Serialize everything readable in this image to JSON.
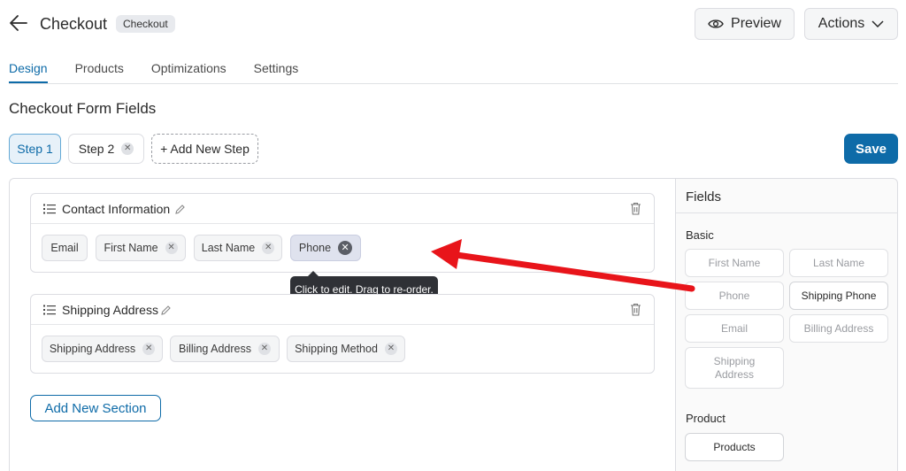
{
  "header": {
    "title": "Checkout",
    "badge": "Checkout",
    "preview_label": "Preview",
    "actions_label": "Actions"
  },
  "tabs": [
    {
      "label": "Design",
      "active": true
    },
    {
      "label": "Products",
      "active": false
    },
    {
      "label": "Optimizations",
      "active": false
    },
    {
      "label": "Settings",
      "active": false
    }
  ],
  "section_title": "Checkout Form Fields",
  "steps": {
    "step1": "Step 1",
    "step2": "Step 2",
    "add_step": "+ Add New Step"
  },
  "save_label": "Save",
  "sections": [
    {
      "title": "Contact Information",
      "fields": [
        "Email",
        "First Name",
        "Last Name",
        "Phone"
      ],
      "selected": "Phone"
    },
    {
      "title": "Shipping Address",
      "fields": [
        "Shipping Address",
        "Billing Address",
        "Shipping Method"
      ]
    }
  ],
  "tooltip": "Click to edit. Drag to re-order.",
  "add_section_label": "Add New Section",
  "fields_panel": {
    "title": "Fields",
    "basic_label": "Basic",
    "basic_fields": [
      "First Name",
      "Last Name",
      "Phone",
      "Shipping Phone",
      "Email",
      "Billing Address",
      "Shipping Address"
    ],
    "product_label": "Product",
    "product_fields": [
      "Products"
    ]
  },
  "colors": {
    "accent": "#0e6ba8",
    "annotation_arrow": "#e8141a"
  }
}
